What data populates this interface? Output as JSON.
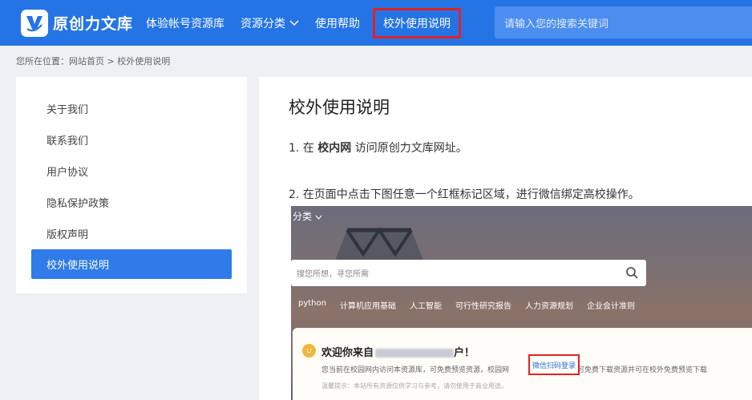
{
  "header": {
    "logo_text": "原创力文库",
    "nav": [
      {
        "label": "体验帐号资源库"
      },
      {
        "label": "资源分类"
      },
      {
        "label": "使用帮助"
      },
      {
        "label": "校外使用说明"
      }
    ],
    "search_placeholder": "请输入您的搜索关键词",
    "brand_color": "#2474e6",
    "highlight_color": "#e52124"
  },
  "breadcrumb": {
    "prefix": "您所在位置：",
    "home": "网站首页",
    "separator": " > ",
    "current": "校外使用说明"
  },
  "sidebar": {
    "items": [
      {
        "label": "关于我们"
      },
      {
        "label": "联系我们"
      },
      {
        "label": "用户协议"
      },
      {
        "label": "隐私保护政策"
      },
      {
        "label": "版权声明"
      },
      {
        "label": "校外使用说明"
      }
    ]
  },
  "content": {
    "title": "校外使用说明",
    "step1_pre": "1. 在 ",
    "step1_bold": "校内网",
    "step1_post": " 访问原创力文库网址。",
    "step2": "2. 在页面中点击下图任意一个红框标记区域，进行微信绑定高校操作。"
  },
  "screenshot": {
    "category": "分类",
    "search_placeholder": "搜您所想，寻您所需",
    "tags": [
      "python",
      "计算机应用基础",
      "人工智能",
      "可行性研究报告",
      "人力资源规划",
      "企业会计准则"
    ],
    "welcome": "欢迎你来自",
    "welcome_suffix": "户！",
    "desc_pre": "您当前在校园网内访问本资源库，可免费预览资源，校园网",
    "login": "微信扫码登录",
    "desc_post": "后可免费下载资源并可在校外免费预览下载",
    "tip": "温馨提示：本站所有资源仅供学习与参考，请勿使用于商业用途。"
  }
}
